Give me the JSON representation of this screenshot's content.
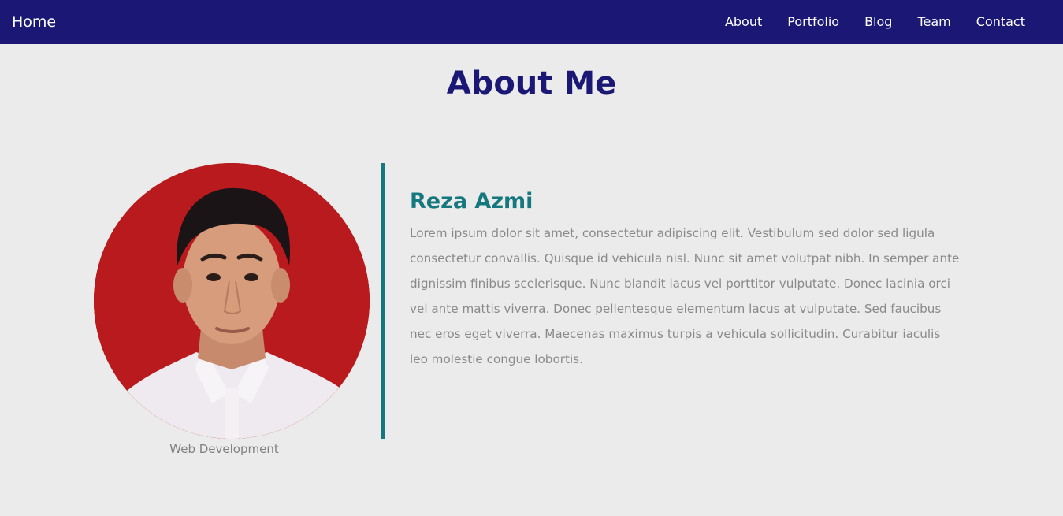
{
  "navbar": {
    "brand": "Home",
    "links": [
      "About",
      "Portfolio",
      "Blog",
      "Team",
      "Contact"
    ]
  },
  "page_title": "About Me",
  "profile": {
    "caption": "Web Development",
    "name": "Reza Azmi",
    "bio": "Lorem ipsum dolor sit amet, consectetur adipiscing elit. Vestibulum sed dolor sed ligula consectetur convallis. Quisque id vehicula nisl. Nunc sit amet volutpat nibh. In semper ante dignissim finibus scelerisque. Nunc blandit lacus vel porttitor vulputate. Donec lacinia orci vel ante mattis viverra. Donec pellentesque elementum lacus at vulputate. Sed faucibus nec eros eget viverra. Maecenas maximus turpis a vehicula sollicitudin. Curabitur iaculis leo molestie congue lobortis."
  },
  "colors": {
    "navbar_bg": "#1a1874",
    "page_bg": "#ebebeb",
    "accent": "#14787e",
    "photo_bg": "#b0171c"
  }
}
